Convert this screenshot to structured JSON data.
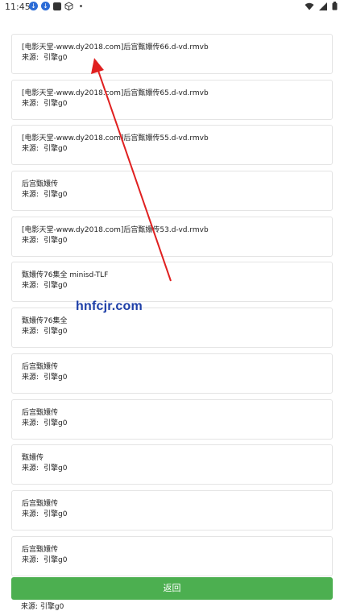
{
  "status_bar": {
    "time": "11:45",
    "left_icons": [
      "download-icon",
      "download-icon",
      "square-app-icon",
      "cube-icon",
      "dot-icon"
    ],
    "right_icons": [
      "wifi-icon",
      "signal-icon",
      "battery-icon"
    ]
  },
  "source_label": "来源:",
  "items": [
    {
      "title": "[电影天堂-www.dy2018.com]后宫甄嬛传66.d-vd.rmvb",
      "source": "引擎g0"
    },
    {
      "title": "[电影天堂-www.dy2018.com]后宫甄嬛传65.d-vd.rmvb",
      "source": "引擎g0"
    },
    {
      "title": "[电影天堂-www.dy2018.com]后宫甄嬛传55.d-vd.rmvb",
      "source": "引擎g0"
    },
    {
      "title": "后宫甄嬛传",
      "source": "引擎g0"
    },
    {
      "title": "[电影天堂-www.dy2018.com]后宫甄嬛传53.d-vd.rmvb",
      "source": "引擎g0"
    },
    {
      "title": "甄嬛传76集全 minisd-TLF",
      "source": "引擎g0"
    },
    {
      "title": "甄嬛传76集全",
      "source": "引擎g0"
    },
    {
      "title": "后宫甄嬛传",
      "source": "引擎g0"
    },
    {
      "title": "后宫甄嬛传",
      "source": "引擎g0"
    },
    {
      "title": "甄嬛传",
      "source": "引擎g0"
    },
    {
      "title": "后宫甄嬛传",
      "source": "引擎g0"
    },
    {
      "title": "后宫甄嬛传",
      "source": "引擎g0"
    }
  ],
  "trailing_source": "来源:  引擎g0",
  "back_button": "返回",
  "watermark": "hnfcjr.com",
  "annotation_color": "#e02020"
}
